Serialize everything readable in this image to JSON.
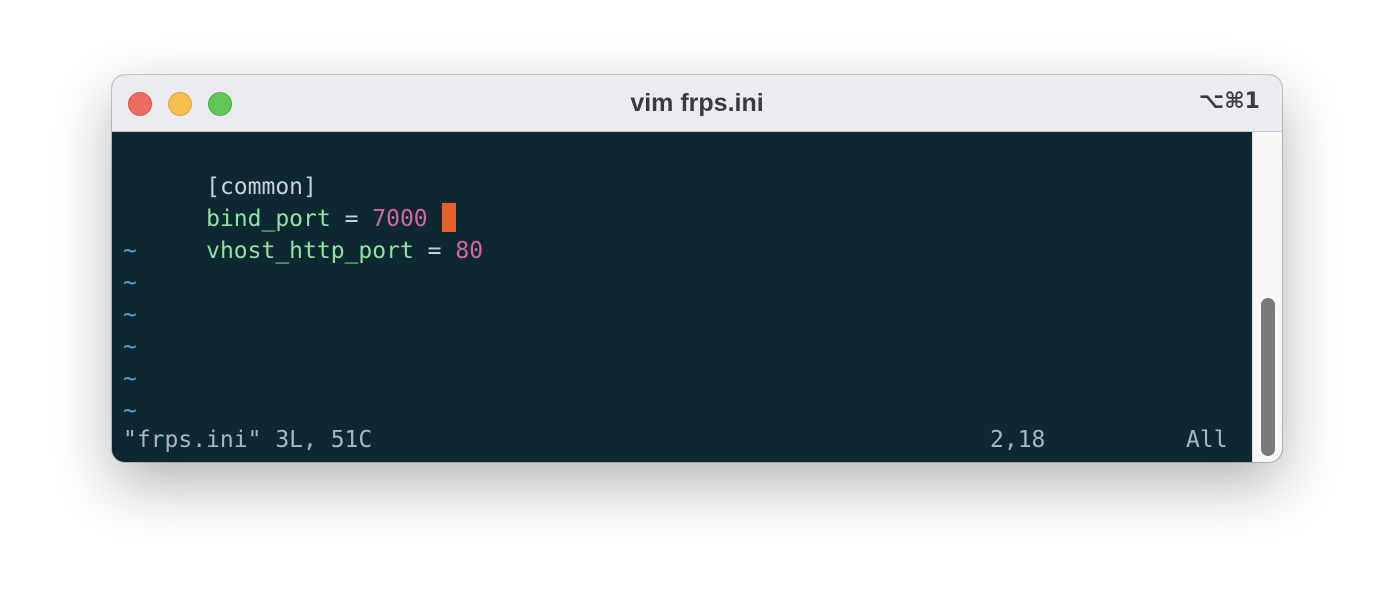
{
  "window": {
    "title": "vim frps.ini",
    "shortcut": "⌥⌘1"
  },
  "editor": {
    "lines": [
      {
        "text": "[common]"
      },
      {
        "key": "bind_port",
        "op": " = ",
        "value": "7000"
      },
      {
        "key": "vhost_http_port",
        "op": " = ",
        "value": "80"
      }
    ],
    "empty_markers": [
      "~",
      "~",
      "~",
      "~",
      "~",
      "~"
    ]
  },
  "status_line": {
    "file_info": "\"frps.ini\" 3L, 51C",
    "cursor_position": "2,18",
    "scroll_position": "All"
  },
  "colors": {
    "background": "#0d2833",
    "key": "#8fe3a0",
    "number": "#d4679a",
    "tilde": "#4ea3d9",
    "cursor": "#e8612c"
  }
}
